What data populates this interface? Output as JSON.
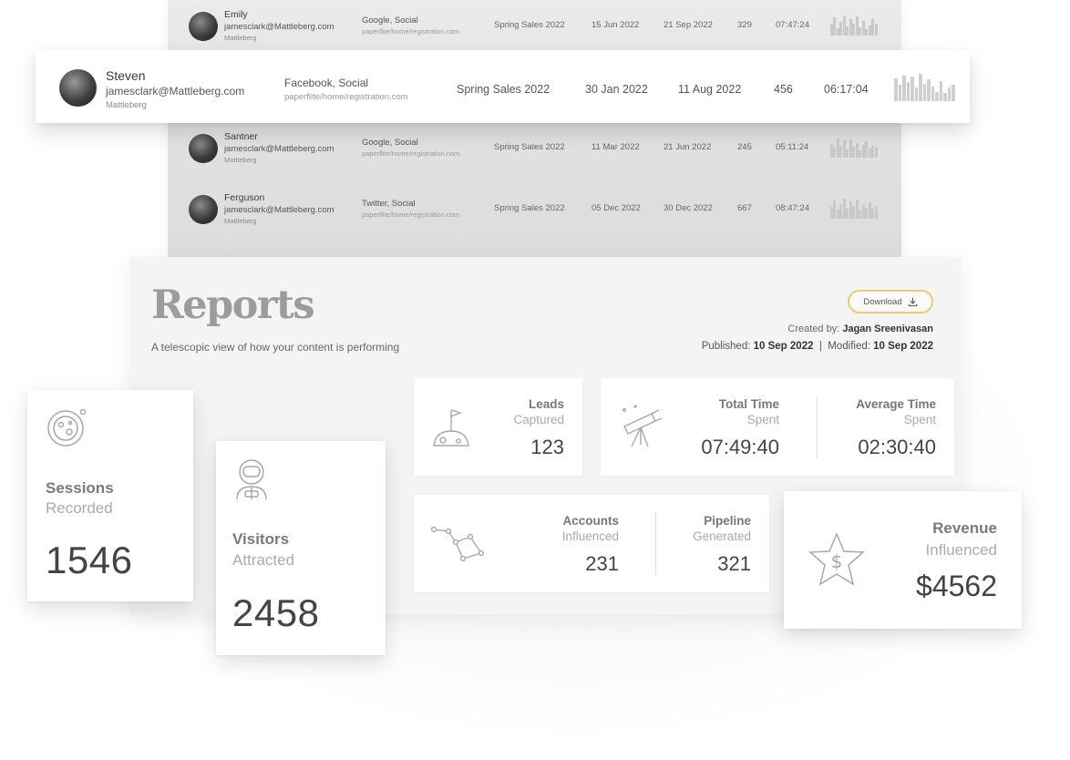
{
  "table": {
    "rows_top": [
      {
        "name": "Emily",
        "email": "jamesclark@Mattleberg.com",
        "company": "Mattleberg",
        "source": "Google, Social",
        "url": "paperflite/home/registration.com",
        "campaign": "Spring Sales 2022",
        "date1": "15 Jun 2022",
        "date2": "21 Sep 2022",
        "count": "329",
        "time": "07:47:24",
        "spark": [
          0.55,
          0.9,
          0.35,
          0.7,
          1.0,
          0.45,
          0.8,
          0.6,
          0.95,
          0.4,
          0.75,
          0.3,
          0.5,
          0.85,
          0.6
        ]
      }
    ],
    "highlighted": {
      "name": "Steven",
      "email": "jamesclark@Mattleberg.com",
      "company": "Mattleberg",
      "source": "Facebook, Social",
      "url": "paperflite/home/registration.com",
      "campaign": "Spring Sales 2022",
      "date1": "30 Jan 2022",
      "date2": "11 Aug 2022",
      "count": "456",
      "time": "06:17:04",
      "spark": [
        0.85,
        0.6,
        0.95,
        0.7,
        0.9,
        0.5,
        1.0,
        0.65,
        0.8,
        0.55,
        0.35,
        0.75,
        0.3,
        0.5,
        0.6
      ]
    },
    "rows_bottom": [
      {
        "name": "Santner",
        "email": "jamesclark@Mattleberg.com",
        "company": "Mattleberg",
        "source": "Google, Social",
        "url": "paperflite/home/registration.com",
        "campaign": "Spring Sales 2022",
        "date1": "11 Mar 2022",
        "date2": "21 Jun  2022",
        "count": "245",
        "time": "05:11:24",
        "spark": [
          0.7,
          0.5,
          0.95,
          0.6,
          0.85,
          0.4,
          0.9,
          0.55,
          0.75,
          0.35,
          0.65,
          0.8,
          0.45,
          0.6,
          0.5
        ]
      },
      {
        "name": "Ferguson",
        "email": "jamesclark@Mattleberg.com",
        "company": "Mattleberg",
        "source": "Twitter, Social",
        "url": "paperflite/home/registration.com",
        "campaign": "Spring Sales 2022",
        "date1": "05 Dec 2022",
        "date2": "30 Dec 2022",
        "count": "667",
        "time": "08:47:24",
        "spark": [
          0.6,
          0.9,
          0.45,
          0.75,
          1.0,
          0.5,
          0.85,
          0.65,
          0.95,
          0.4,
          0.7,
          0.55,
          0.8,
          0.5,
          0.65
        ]
      }
    ]
  },
  "reports": {
    "title": "Reports",
    "subtitle": "A telescopic view of how your content is performing",
    "download_label": "Download",
    "created_by_label": "Created by:",
    "created_by": "Jagan Sreenivasan",
    "published_label": "Published:",
    "published": "10 Sep 2022",
    "separator": "|",
    "modified_label": "Modified:",
    "modified": "10 Sep 2022"
  },
  "stats": {
    "leads": {
      "line1": "Leads",
      "line2": "Captured",
      "value": "123"
    },
    "total_time": {
      "line1": "Total Time",
      "line2": "Spent",
      "value": "07:49:40"
    },
    "average_time": {
      "line1": "Average Time",
      "line2": "Spent",
      "value": "02:30:40"
    },
    "accounts": {
      "line1": "Accounts",
      "line2": "Influenced",
      "value": "231"
    },
    "pipeline": {
      "line1": "Pipeline",
      "line2": "Generated",
      "value": "321"
    },
    "sessions": {
      "line1": "Sessions",
      "line2": "Recorded",
      "value": "1546"
    },
    "visitors": {
      "line1": "Visitors",
      "line2": "Attracted",
      "value": "2458"
    },
    "revenue": {
      "line1": "Revenue",
      "line2": "Influenced",
      "value": "$4562"
    }
  },
  "colors": {
    "accent_outline": "#e6cf72",
    "text_dark": "#444444",
    "text_muted": "#aaaaaa"
  },
  "icons": [
    "download-icon",
    "moon-flag-icon",
    "telescope-icon",
    "constellation-icon",
    "planet-icon",
    "astronaut-icon",
    "star-dollar-icon"
  ]
}
